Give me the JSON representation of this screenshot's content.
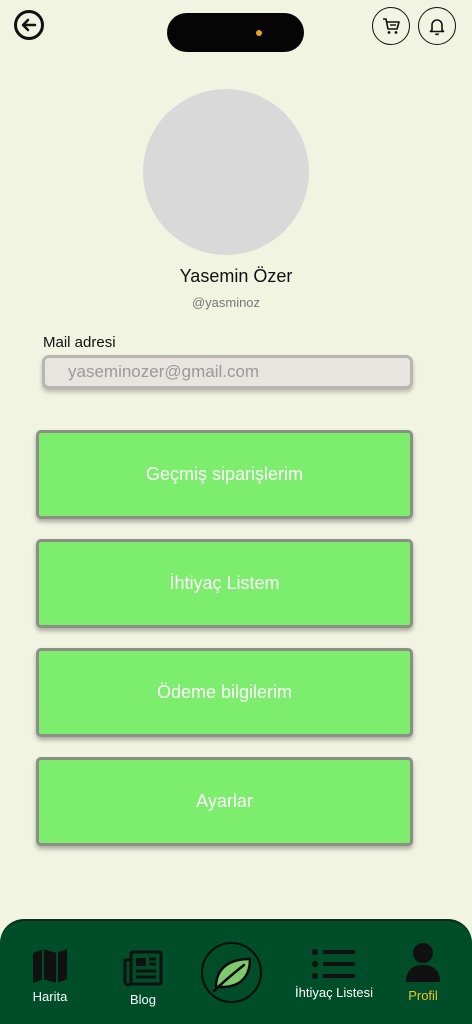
{
  "header": {
    "back_icon": "back-arrow-circle-icon",
    "cart_icon": "cart-icon",
    "bell_icon": "bell-icon"
  },
  "profile": {
    "name": "Yasemin Özer",
    "handle": "@yasminoz"
  },
  "mail": {
    "label": "Mail adresi",
    "value": "yaseminozer@gmail.com"
  },
  "menu": [
    {
      "label": "Geçmiş siparişlerim"
    },
    {
      "label": "İhtiyaç Listem"
    },
    {
      "label": "Ödeme bilgilerim"
    },
    {
      "label": "Ayarlar"
    }
  ],
  "nav": {
    "map": "Harita",
    "blog": "Blog",
    "center_icon": "leaf-icon",
    "needs": "İhtiyaç Listesi",
    "profile": "Profil",
    "active": "Profil"
  },
  "colors": {
    "background": "#f2f4e2",
    "button_green": "#7ced6c",
    "nav_bg": "#004d2a",
    "active_nav": "#e8c22a"
  }
}
